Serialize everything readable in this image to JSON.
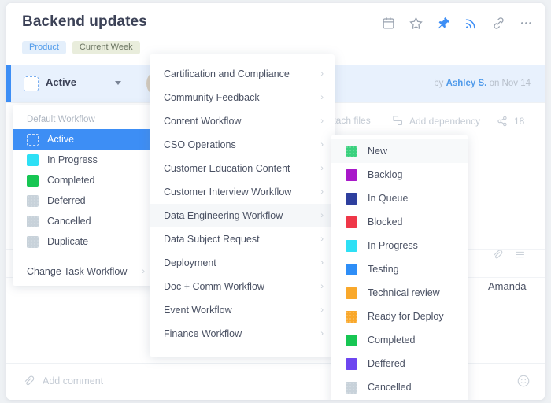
{
  "header": {
    "title": "Backend updates",
    "pills": [
      {
        "label": "Product",
        "style": "blue"
      },
      {
        "label": "Current Week",
        "style": "green"
      }
    ],
    "icons": [
      {
        "name": "calendar-icon",
        "active": false
      },
      {
        "name": "star-icon",
        "active": false
      },
      {
        "name": "pin-icon",
        "active": true
      },
      {
        "name": "rss-icon",
        "active": true
      },
      {
        "name": "link-icon",
        "active": false
      },
      {
        "name": "more-options-icon",
        "active": false
      }
    ]
  },
  "status_row": {
    "label": "Active",
    "caret": "▾"
  },
  "byline": {
    "prefix": "by",
    "author": "Ashley S.",
    "suffix": "on Nov 14"
  },
  "meta": {
    "attach_files": "Attach files",
    "add_dependency": "Add dependency",
    "share_count": "18"
  },
  "body": {
    "assignee": "Amanda"
  },
  "comment_bar": {
    "placeholder": "Add comment"
  },
  "workflow_menu": {
    "header": "Default Workflow",
    "items": [
      {
        "label": "Active",
        "color": "",
        "selected": true,
        "swatch": "dashed"
      },
      {
        "label": "In Progress",
        "color": "#2ee0f5",
        "selected": false,
        "swatch": "solid"
      },
      {
        "label": "Completed",
        "color": "#17c653",
        "selected": false,
        "swatch": "solid"
      },
      {
        "label": "Deferred",
        "color": "",
        "selected": false,
        "swatch": "grey"
      },
      {
        "label": "Cancelled",
        "color": "",
        "selected": false,
        "swatch": "grey"
      },
      {
        "label": "Duplicate",
        "color": "",
        "selected": false,
        "swatch": "grey"
      }
    ],
    "footer": {
      "label": "Change Task Workflow",
      "arrow": "›"
    }
  },
  "submenu": {
    "items": [
      {
        "label": "Cartification and Compliance",
        "arrow": "›",
        "hovered": false
      },
      {
        "label": "Community Feedback",
        "arrow": "›",
        "hovered": false
      },
      {
        "label": "Content Workflow",
        "arrow": "›",
        "hovered": false
      },
      {
        "label": "CSO Operations",
        "arrow": "›",
        "hovered": false
      },
      {
        "label": "Customer Education Content",
        "arrow": "›",
        "hovered": false
      },
      {
        "label": "Customer Interview Workflow",
        "arrow": "›",
        "hovered": false
      },
      {
        "label": "Data Engineering Workflow",
        "arrow": "›",
        "hovered": true
      },
      {
        "label": "Data Subject Request",
        "arrow": "›",
        "hovered": false
      },
      {
        "label": "Deployment",
        "arrow": "›",
        "hovered": false
      },
      {
        "label": "Doc + Comm Workflow",
        "arrow": "›",
        "hovered": false
      },
      {
        "label": "Event Workflow",
        "arrow": "›",
        "hovered": false
      },
      {
        "label": "Finance Workflow",
        "arrow": "›",
        "hovered": false
      }
    ]
  },
  "status_menu": {
    "items": [
      {
        "label": "New",
        "color": "#3ad17e",
        "hovered": true,
        "textured": true
      },
      {
        "label": "Backlog",
        "color": "#a818c9",
        "hovered": false,
        "textured": false
      },
      {
        "label": "In Queue",
        "color": "#2e3f9e",
        "hovered": false,
        "textured": false
      },
      {
        "label": "Blocked",
        "color": "#ef3748",
        "hovered": false,
        "textured": false
      },
      {
        "label": "In Progress",
        "color": "#2ee0f5",
        "hovered": false,
        "textured": false
      },
      {
        "label": "Testing",
        "color": "#2e8ef7",
        "hovered": false,
        "textured": false
      },
      {
        "label": "Technical review",
        "color": "#f9a82b",
        "hovered": false,
        "textured": false
      },
      {
        "label": "Ready for Deploy",
        "color": "#f9a82b",
        "hovered": false,
        "textured": true
      },
      {
        "label": "Completed",
        "color": "#17c653",
        "hovered": false,
        "textured": false
      },
      {
        "label": "Deffered",
        "color": "#6d46f0",
        "hovered": false,
        "textured": false
      },
      {
        "label": "Cancelled",
        "color": "#c8d2da",
        "hovered": false,
        "textured": true
      }
    ]
  },
  "colors": {
    "accent": "#3d8ef5",
    "selected_row": "#3d8ef5",
    "status_row_bg": "#e8f1fd",
    "text": "#4a5163"
  }
}
